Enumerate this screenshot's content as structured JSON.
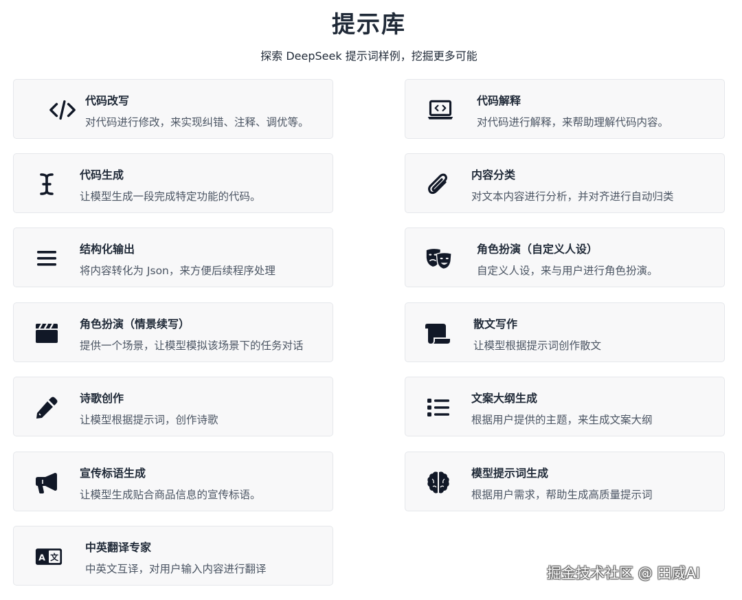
{
  "header": {
    "title": "提示库",
    "subtitle": "探索 DeepSeek 提示词样例，挖掘更多可能"
  },
  "cards": [
    {
      "name": "代码改写",
      "desc": "对代码进行修改，来实现纠错、注释、调优等。",
      "icon": "code-icon"
    },
    {
      "name": "代码解释",
      "desc": "对代码进行解释，来帮助理解代码内容。",
      "icon": "laptop-code-icon"
    },
    {
      "name": "代码生成",
      "desc": "让模型生成一段完成特定功能的代码。",
      "icon": "text-cursor-icon"
    },
    {
      "name": "内容分类",
      "desc": "对文本内容进行分析，并对齐进行自动归类",
      "icon": "paperclip-icon"
    },
    {
      "name": "结构化输出",
      "desc": "将内容转化为 Json，来方便后续程序处理",
      "icon": "bars-icon"
    },
    {
      "name": "角色扮演（自定义人设）",
      "desc": "自定义人设，来与用户进行角色扮演。",
      "icon": "theater-masks-icon"
    },
    {
      "name": "角色扮演（情景续写）",
      "desc": "提供一个场景，让模型模拟该场景下的任务对话",
      "icon": "clapperboard-icon"
    },
    {
      "name": "散文写作",
      "desc": "让模型根据提示词创作散文",
      "icon": "scroll-icon"
    },
    {
      "name": "诗歌创作",
      "desc": "让模型根据提示词，创作诗歌",
      "icon": "pencil-icon"
    },
    {
      "name": "文案大纲生成",
      "desc": "根据用户提供的主题，来生成文案大纲",
      "icon": "list-icon"
    },
    {
      "name": "宣传标语生成",
      "desc": "让模型生成贴合商品信息的宣传标语。",
      "icon": "bullhorn-icon"
    },
    {
      "name": "模型提示词生成",
      "desc": "根据用户需求，帮助生成高质量提示词",
      "icon": "brain-icon"
    },
    {
      "name": "中英翻译专家",
      "desc": "中英文互译，对用户输入内容进行翻译",
      "icon": "language-icon"
    }
  ],
  "watermark": "掘金技术社区 @ 田威AI",
  "colors": {
    "card_bg": "#f8f8f9",
    "card_border": "#e5e7eb",
    "icon": "#111827",
    "title_text": "#1f2937",
    "desc_text": "#4b5563"
  }
}
